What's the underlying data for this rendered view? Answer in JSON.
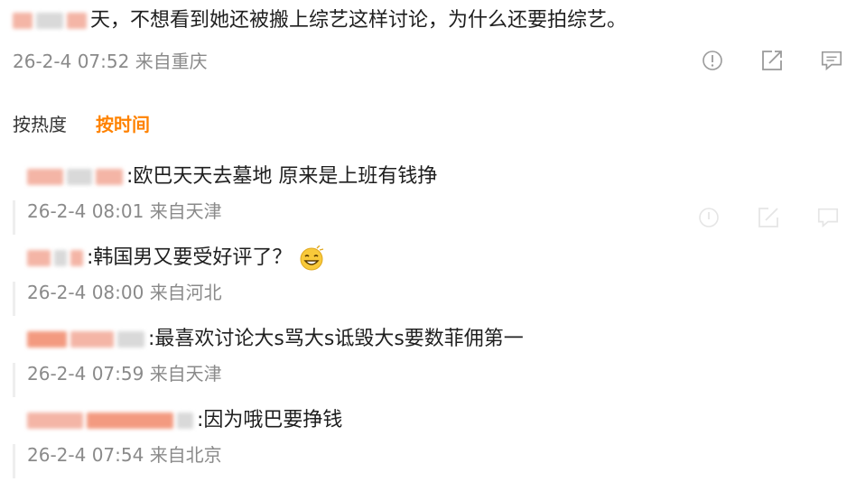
{
  "top_comment": {
    "text": "天，不想看到她还被搬上综艺这样讨论，为什么还要拍综艺。",
    "date": "26-2-4 07:52",
    "location": "来自重庆",
    "icons": [
      "report-icon",
      "share-icon",
      "comment-icon"
    ]
  },
  "sort": {
    "hot_label": "按热度",
    "time_label": "按时间"
  },
  "replies": [
    {
      "text": ":欧巴天天去墓地 原来是上班有钱挣",
      "date": "26-2-4 08:01",
      "location": "来自天津"
    },
    {
      "text": ":韩国男又要受好评了？",
      "date": "26-2-4 08:00",
      "location": "来自河北",
      "emoji": "grinning-face-emoji"
    },
    {
      "text": ":最喜欢讨论大s骂大s诋毁大s要数菲佣第一",
      "date": "26-2-4 07:59",
      "location": "来自天津"
    },
    {
      "text": ":因为哦巴要挣钱",
      "date": "26-2-4 07:54",
      "location": "来自北京"
    }
  ],
  "colors": {
    "accent": "#ff8200",
    "meta_text": "#8a8a8a",
    "body_text": "#1f1f1f"
  }
}
